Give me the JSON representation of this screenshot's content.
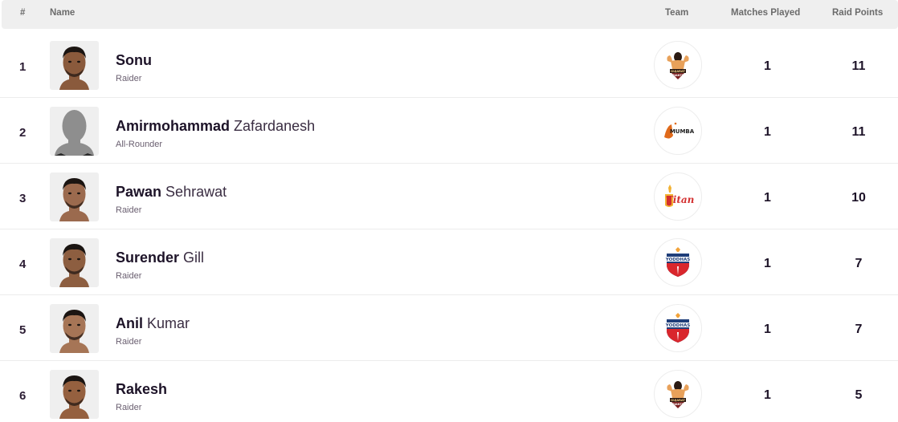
{
  "table": {
    "headers": {
      "rank": "#",
      "name": "Name",
      "team": "Team",
      "matches_played": "Matches Played",
      "raid_points": "Raid Points"
    },
    "rows": [
      {
        "rank": "1",
        "first_name": "Sonu",
        "last_name": "",
        "role": "Raider",
        "team_logo": "gujarat-giants-logo",
        "matches_played": "1",
        "raid_points": "11",
        "photo": "player-photo"
      },
      {
        "rank": "2",
        "first_name": "Amirmohammad",
        "last_name": "Zafardanesh",
        "role": "All-Rounder",
        "team_logo": "u-mumba-logo",
        "matches_played": "1",
        "raid_points": "11",
        "photo": "placeholder-silhouette"
      },
      {
        "rank": "3",
        "first_name": "Pawan",
        "last_name": "Sehrawat",
        "role": "Raider",
        "team_logo": "telugu-titans-logo",
        "matches_played": "1",
        "raid_points": "10",
        "photo": "player-photo"
      },
      {
        "rank": "4",
        "first_name": "Surender",
        "last_name": "Gill",
        "role": "Raider",
        "team_logo": "up-yoddhas-logo",
        "matches_played": "1",
        "raid_points": "7",
        "photo": "player-photo"
      },
      {
        "rank": "5",
        "first_name": "Anil",
        "last_name": "Kumar",
        "role": "Raider",
        "team_logo": "up-yoddhas-logo",
        "matches_played": "1",
        "raid_points": "7",
        "photo": "player-photo"
      },
      {
        "rank": "6",
        "first_name": "Rakesh",
        "last_name": "",
        "role": "Raider",
        "team_logo": "gujarat-giants-logo",
        "matches_played": "1",
        "raid_points": "5",
        "photo": "player-photo"
      }
    ]
  },
  "team_logos": {
    "gujarat-giants-logo": {
      "text": "GIANTS",
      "primary": "#e8a15a",
      "secondary": "#7a1f1f"
    },
    "u-mumba-logo": {
      "text": "MUMBA",
      "primary": "#e06a1b",
      "secondary": "#1d1d1d"
    },
    "telugu-titans-logo": {
      "text": "Titans",
      "primary": "#d32f2f",
      "secondary": "#f2b233"
    },
    "up-yoddhas-logo": {
      "text": "YODDHAS",
      "primary": "#1f3e7a",
      "secondary": "#d9262c"
    }
  }
}
